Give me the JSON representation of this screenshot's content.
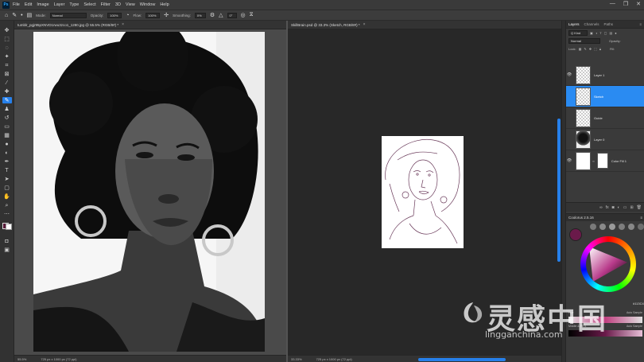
{
  "menubar": {
    "logo": "Ps",
    "items": [
      "File",
      "Edit",
      "Image",
      "Layer",
      "Type",
      "Select",
      "Filter",
      "3D",
      "View",
      "Window",
      "Help"
    ],
    "window_controls": [
      "—",
      "❐",
      "✕"
    ]
  },
  "options": {
    "mode_label": "Mode:",
    "mode_value": "Normal",
    "opacity_label": "Opacity:",
    "opacity_value": "100%",
    "flow_label": "Flow:",
    "flow_value": "100%",
    "smoothing_label": "Smoothing:",
    "smoothing_value": "0%",
    "angle_value": "0°"
  },
  "doc1": {
    "tab_title": "tumblr_pgjr95pXNVD1rwu3zco1_1280.jpg @ 55.5% (RGB/8#) *",
    "zoom": "55.5%",
    "dims": "725 px x 1000 px (72 ppi)"
  },
  "doc2": {
    "tab_title": "SkillBrain.psd @ 33.3% (Sketch, RGB/8#) *",
    "zoom": "33.33%",
    "dims": "725 px x 1000 px (72 ppi)"
  },
  "layers_panel": {
    "tabs": [
      "Layers",
      "Channels",
      "Paths"
    ],
    "filter_label": "Q Kind",
    "blend": "Normal",
    "opacity_label": "Opacity:",
    "lock_label": "Lock:",
    "fill_label": "Fill:",
    "layers": [
      {
        "name": "Layer 1",
        "visible": true,
        "selected": false
      },
      {
        "name": "Sketch",
        "visible": false,
        "selected": true
      },
      {
        "name": "Guide",
        "visible": false,
        "selected": false
      },
      {
        "name": "Layer 0",
        "visible": false,
        "selected": false
      },
      {
        "name": "Color Fill 1",
        "visible": true,
        "selected": false
      }
    ]
  },
  "coolorus": {
    "title": "Coolorus 2.5.16",
    "hex": "#113C42",
    "row1_left": "Hue",
    "row1_right": "Auto Sample",
    "row2_left": "Middle & Ptr S",
    "row2_right": "Auto Sample"
  },
  "watermark": {
    "main": "灵感中国",
    "sub": "lingganchina.com"
  },
  "colors": {
    "accent": "#2680eb",
    "selected_layer": "#2a8bf2",
    "current_color": "#6a1a4a"
  }
}
